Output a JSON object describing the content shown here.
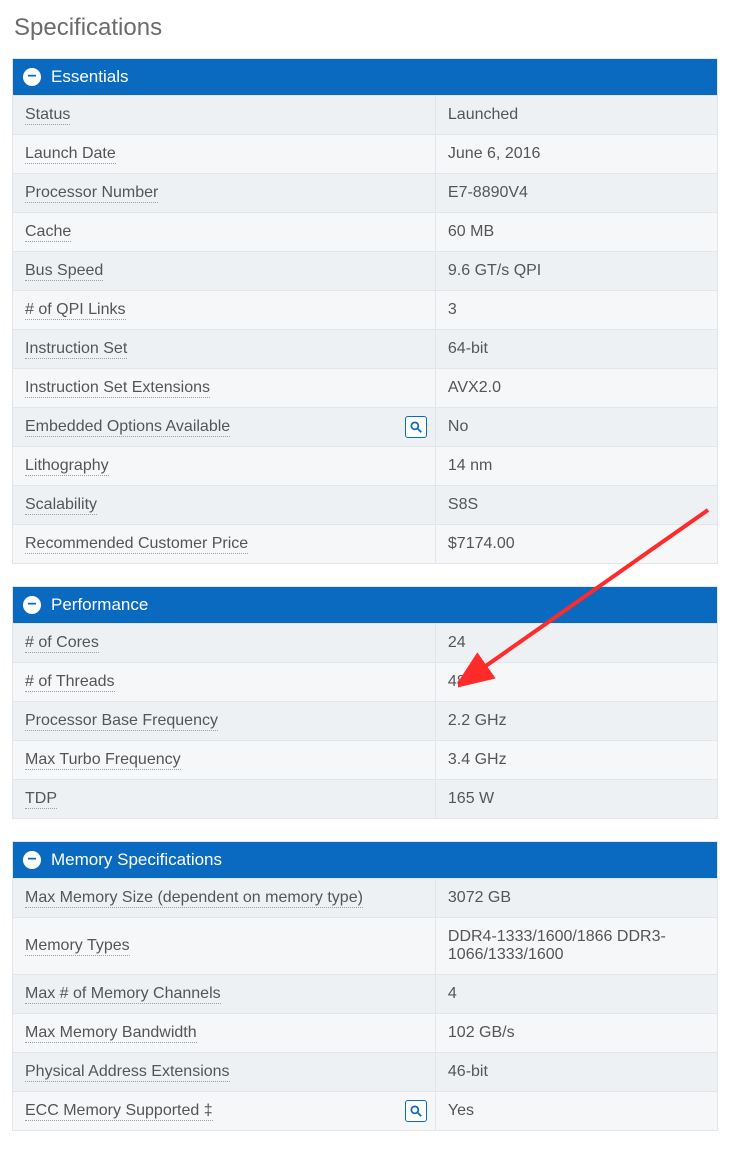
{
  "title": "Specifications",
  "sections": [
    {
      "title": "Essentials",
      "rows": [
        {
          "label": "Status",
          "value": "Launched",
          "hasMag": false
        },
        {
          "label": "Launch Date",
          "value": "June 6, 2016",
          "hasMag": false
        },
        {
          "label": "Processor Number",
          "value": "E7-8890V4",
          "hasMag": false
        },
        {
          "label": "Cache",
          "value": "60 MB",
          "hasMag": false
        },
        {
          "label": "Bus Speed",
          "value": "9.6 GT/s QPI",
          "hasMag": false
        },
        {
          "label": "# of QPI Links",
          "value": "3",
          "hasMag": false
        },
        {
          "label": "Instruction Set",
          "value": "64-bit",
          "hasMag": false
        },
        {
          "label": "Instruction Set Extensions",
          "value": "AVX2.0",
          "hasMag": false
        },
        {
          "label": "Embedded Options Available",
          "value": "No",
          "hasMag": true
        },
        {
          "label": "Lithography",
          "value": "14 nm",
          "hasMag": false
        },
        {
          "label": "Scalability",
          "value": "S8S",
          "hasMag": false
        },
        {
          "label": "Recommended Customer Price",
          "value": "$7174.00",
          "hasMag": false
        }
      ]
    },
    {
      "title": "Performance",
      "rows": [
        {
          "label": "# of Cores",
          "value": "24",
          "hasMag": false
        },
        {
          "label": "# of Threads",
          "value": "48",
          "hasMag": false
        },
        {
          "label": "Processor Base Frequency",
          "value": "2.2 GHz",
          "hasMag": false
        },
        {
          "label": "Max Turbo Frequency",
          "value": "3.4 GHz",
          "hasMag": false
        },
        {
          "label": "TDP",
          "value": "165 W",
          "hasMag": false
        }
      ]
    },
    {
      "title": "Memory Specifications",
      "rows": [
        {
          "label": "Max Memory Size (dependent on memory type)",
          "value": "3072 GB",
          "hasMag": false
        },
        {
          "label": "Memory Types",
          "value": "DDR4-1333/1600/1866 DDR3-1066/1333/1600",
          "hasMag": false
        },
        {
          "label": "Max # of Memory Channels",
          "value": "4",
          "hasMag": false
        },
        {
          "label": "Max Memory Bandwidth",
          "value": "102 GB/s",
          "hasMag": false
        },
        {
          "label": "Physical Address Extensions",
          "value": "46-bit",
          "hasMag": false
        },
        {
          "label": "ECC Memory Supported ‡",
          "value": "Yes",
          "hasMag": true
        }
      ]
    }
  ]
}
